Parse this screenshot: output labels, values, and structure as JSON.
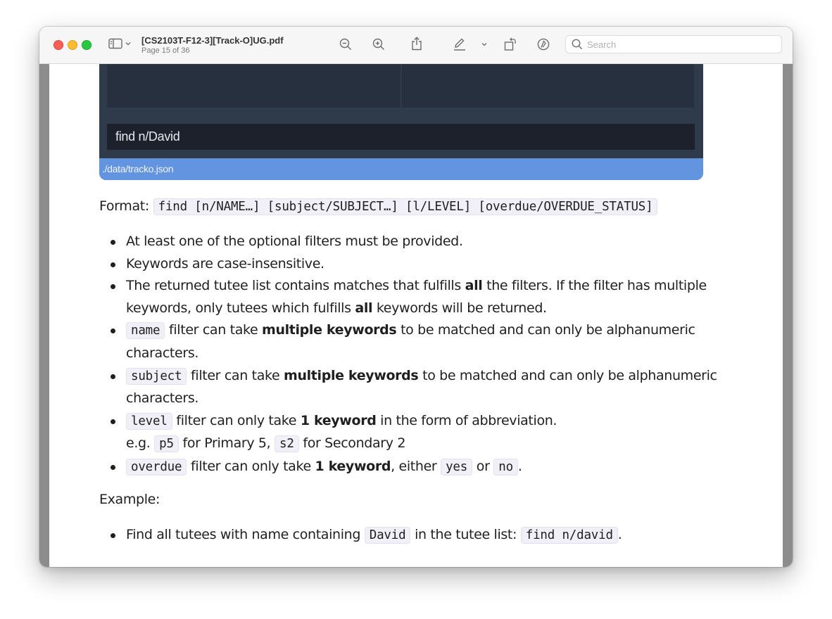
{
  "window": {
    "title": "[CS2103T-F12-3][Track-O]UG.pdf",
    "page_indicator": "Page 15 of 36"
  },
  "toolbar": {
    "icons": [
      "sidebar-icon",
      "chevron-down-icon",
      "zoom-out-icon",
      "zoom-in-icon",
      "share-icon",
      "markup-pen-icon",
      "chevron-down-icon",
      "rotate-icon",
      "markup-circle-icon",
      "search-icon"
    ],
    "search_placeholder": "Search"
  },
  "embedded_screenshot": {
    "command_text": "find n/David",
    "status_text": "./data/tracko.json",
    "colors": {
      "panel": "#27303f",
      "background": "#2f3a4b",
      "command": "#1c212b",
      "status": "#6394e0"
    }
  },
  "document": {
    "format_label": "Format:",
    "format_code": "find [n/NAME…] [subject/SUBJECT…] [l/LEVEL] [overdue/OVERDUE_STATUS]",
    "rules": {
      "r1": "At least one of the optional filters must be provided.",
      "r2": "Keywords are case-insensitive.",
      "r3": {
        "t1": "The returned tutee list contains matches that fulfills ",
        "b1": "all",
        "t2": " the filters. If the filter has multiple keywords, only tutees which fulfills ",
        "b2": "all",
        "t3": " keywords will be returned."
      },
      "r4": {
        "code": "name",
        "t1": " filter can take ",
        "b1": "multiple keywords",
        "t2": " to be matched and can only be alphanumeric characters."
      },
      "r5": {
        "code": "subject",
        "t1": " filter can take ",
        "b1": "multiple keywords",
        "t2": " to be matched and can only be alphanumeric characters."
      },
      "r6": {
        "code": "level",
        "t1": " filter can only take ",
        "b1": "1 keyword",
        "t2": " in the form of abbreviation.",
        "eg": "e.g. ",
        "code2": "p5",
        "t3": " for Primary 5, ",
        "code3": "s2",
        "t4": " for Secondary 2"
      },
      "r7": {
        "code": "overdue",
        "t1": " filter can only take ",
        "b1": "1 keyword",
        "t2": ", either ",
        "code2": "yes",
        "t3": " or ",
        "code3": "no",
        "t4": "."
      }
    },
    "example_label": "Example:",
    "example": {
      "t1": "Find all tutees with name containing ",
      "code1": "David",
      "t2": " in the tutee list: ",
      "code2": "find n/david",
      "t3": "."
    }
  }
}
